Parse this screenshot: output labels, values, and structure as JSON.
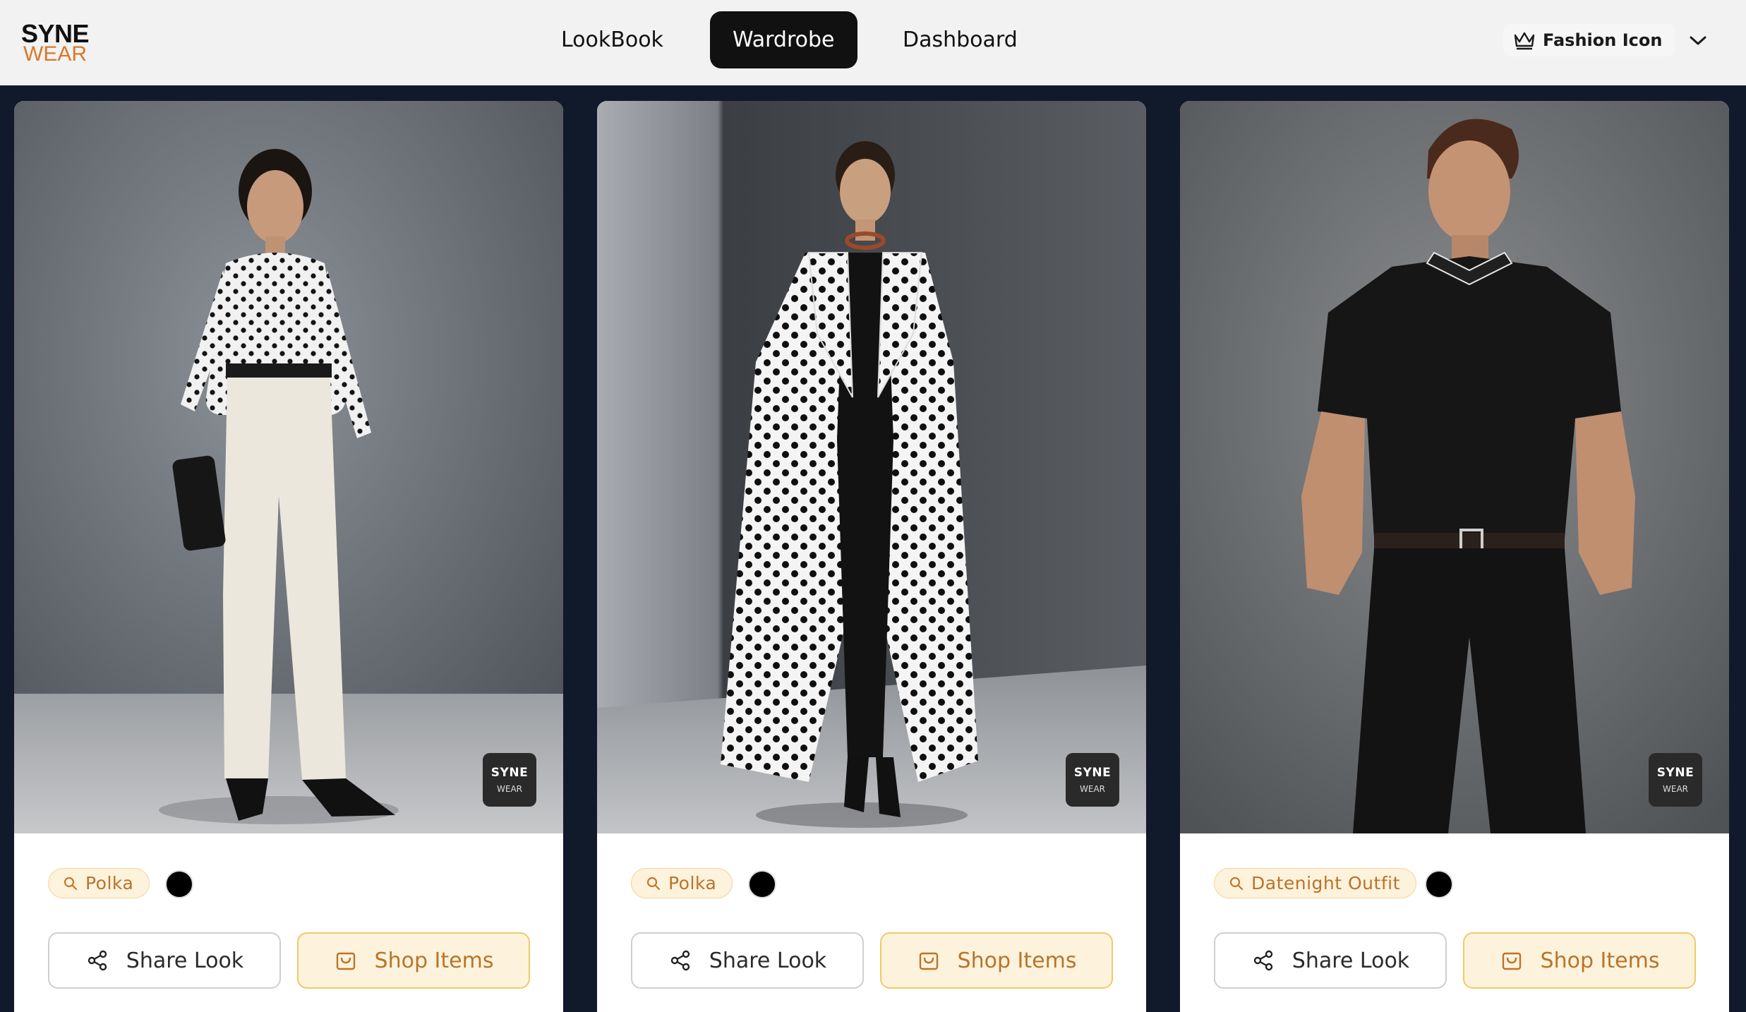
{
  "brand": {
    "line1": "SYNE",
    "line2": "WEAR",
    "accent": "#d9782a"
  },
  "nav": {
    "items": [
      {
        "label": "LookBook",
        "active": false
      },
      {
        "label": "Wardrobe",
        "active": true
      },
      {
        "label": "Dashboard",
        "active": false
      }
    ]
  },
  "user": {
    "label": "Fashion Icon",
    "icon": "crown-icon",
    "menu_icon": "chevron-down-icon"
  },
  "cards": [
    {
      "photo": "woman in white polka-dot zip top, white trousers, black clutch",
      "watermark": {
        "line1": "SYNE",
        "line2": "WEAR"
      },
      "tag": "Polka",
      "swatch_color": "#000000",
      "share_label": "Share Look",
      "shop_label": "Shop Items"
    },
    {
      "photo": "woman in long black and white polka-dot coat over black dress",
      "watermark": {
        "line1": "SYNE",
        "line2": "WEAR"
      },
      "tag": "Polka",
      "swatch_color": "#000000",
      "share_label": "Share Look",
      "shop_label": "Shop Items"
    },
    {
      "photo": "man in black polo shirt and black trousers",
      "watermark": {
        "line1": "SYNE",
        "line2": "WEAR"
      },
      "tag": "Datenight Outfit",
      "swatch_color": "#000000",
      "share_label": "Share Look",
      "shop_label": "Shop Items"
    }
  ],
  "colors": {
    "page_bg": "#111a2a",
    "header_bg": "#f2f2f2",
    "tag_bg": "#fdf2dc",
    "tag_text": "#b9742a",
    "shop_border": "#f0c96c"
  }
}
